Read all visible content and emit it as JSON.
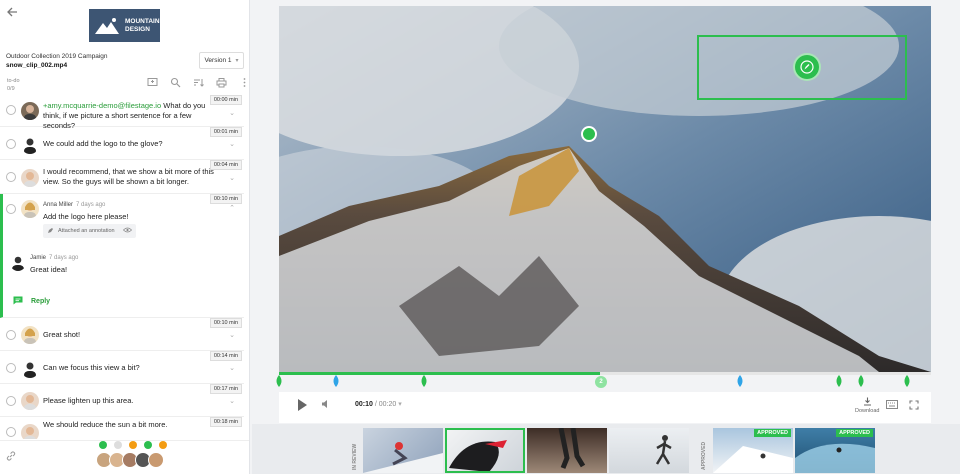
{
  "header": {
    "logo_line1": "MOUNTAIN",
    "logo_line2": "DESIGN",
    "project": "Outdoor Collection 2019 Campaign",
    "file": "snow_clip_002.mp4",
    "version": "Version 1",
    "todo_label": "to-do",
    "todo_count": "0/9"
  },
  "comments": [
    {
      "time": "00:00 min",
      "mention": "+amy.mcquarrie-demo@filestage.io",
      "text": " What do you think, if we picture a short sentence for a few seconds?"
    },
    {
      "time": "00:01 min",
      "text": "We could add the logo to the glove?"
    },
    {
      "time": "00:04 min",
      "text": "I would recommend, that we show a bit more of this view. So the guys will be shown a bit longer."
    },
    {
      "time": "00:10 min",
      "author": "Anna Miller",
      "ago": "7 days ago",
      "text": "Add the logo here please!",
      "annotation": "Attached an annotation"
    },
    {
      "time": "00:10 min",
      "text": "Great shot!"
    },
    {
      "time": "00:14 min",
      "text": "Can we focus this view a bit?"
    },
    {
      "time": "00:17 min",
      "text": "Please lighten up this area."
    },
    {
      "time": "00:18 min",
      "text": "We should reduce the sun a bit more."
    }
  ],
  "reply_thread": {
    "author": "Jamie",
    "ago": "7 days ago",
    "text": "Great idea!",
    "reply_label": "Reply"
  },
  "player": {
    "current": "00:10",
    "duration": "/ 00:20",
    "download_label": "Download",
    "progress_fraction": 0.492,
    "pin_number": "2"
  },
  "filmstrip": {
    "in_review_label": "IN REVIEW",
    "approved_label": "APPROVED",
    "badge": "APPROVED"
  },
  "colors": {
    "accent": "#2cbe4e",
    "marker_blue": "#2fa4e7",
    "logo_bg": "#3d5573"
  }
}
